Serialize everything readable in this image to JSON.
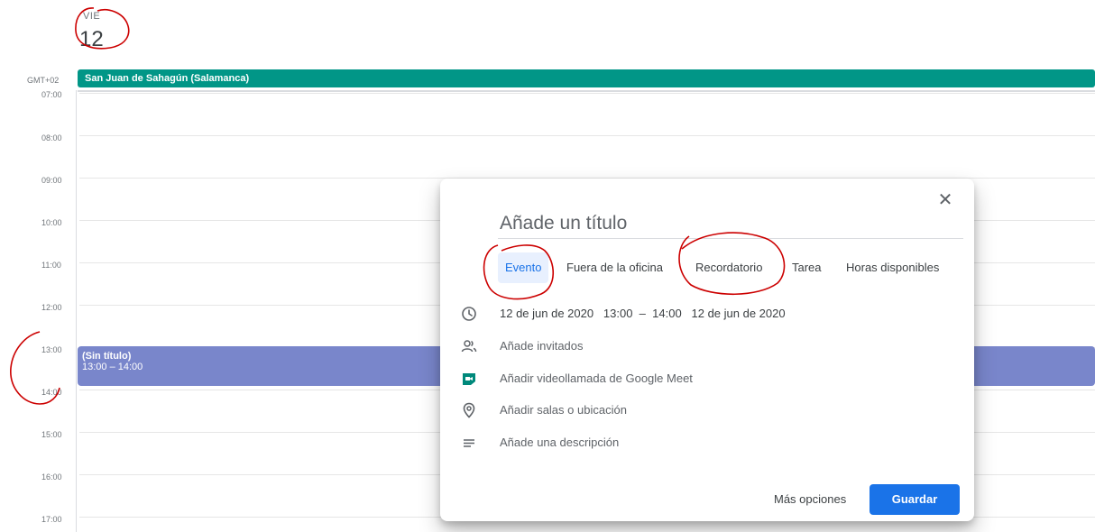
{
  "day_header": {
    "day_name": "VIE",
    "day_number": "12"
  },
  "timezone": "GMT+02",
  "allday_event": {
    "label": "San Juan de Sahagún (Salamanca)",
    "color": "#019687"
  },
  "hours": [
    "07:00",
    "08:00",
    "09:00",
    "10:00",
    "11:00",
    "12:00",
    "13:00",
    "14:00",
    "15:00",
    "16:00",
    "17:00"
  ],
  "event": {
    "title": "(Sin título)",
    "time": "13:00 – 14:00",
    "color": "#7986cb"
  },
  "dialog": {
    "title_placeholder": "Añade un título",
    "tabs": [
      {
        "label": "Evento",
        "active": true
      },
      {
        "label": "Fuera de la oficina",
        "active": false
      },
      {
        "label": "Recordatorio",
        "active": false
      },
      {
        "label": "Tarea",
        "active": false
      },
      {
        "label": "Horas disponibles",
        "active": false
      }
    ],
    "datetime": "12 de jun de 2020   13:00  –  14:00   12 de jun de 2020",
    "guests": "Añade invitados",
    "meet": "Añadir videollamada de Google Meet",
    "location": "Añadir salas o ubicación",
    "description": "Añade una descripción",
    "more_options": "Más opciones",
    "save": "Guardar"
  },
  "colors": {
    "accent": "#1a73e8",
    "annotation": "#cc0000"
  }
}
